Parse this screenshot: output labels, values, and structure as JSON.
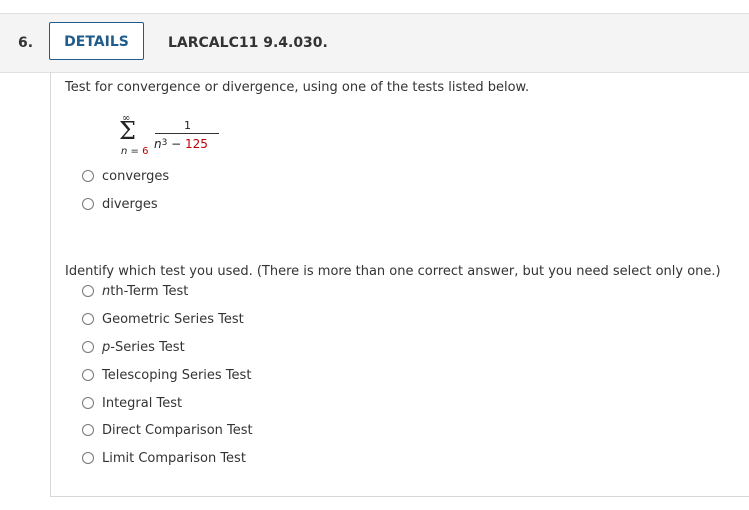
{
  "header": {
    "question_number": "6.",
    "details_label": "DETAILS",
    "problem_id": "LARCALC11 9.4.030."
  },
  "prompt": "Test for convergence or divergence, using one of the tests listed below.",
  "series": {
    "upper": "∞",
    "sigma": "Σ",
    "index_var": "n",
    "index_eq": " = ",
    "index_start": "6",
    "numerator": "1",
    "den_var": "n",
    "den_exp": "3",
    "den_op": " − ",
    "den_const": "125"
  },
  "answer_options": [
    {
      "label": "converges"
    },
    {
      "label": "diverges"
    }
  ],
  "test_prompt": "Identify which test you used. (There is more than one correct answer, but you need select only one.)",
  "test_options": [
    {
      "prefix": "n",
      "label": "th-Term Test"
    },
    {
      "prefix": "",
      "label": "Geometric Series Test"
    },
    {
      "prefix": "p",
      "label": "-Series Test"
    },
    {
      "prefix": "",
      "label": "Telescoping Series Test"
    },
    {
      "prefix": "",
      "label": "Integral Test"
    },
    {
      "prefix": "",
      "label": "Direct Comparison Test"
    },
    {
      "prefix": "",
      "label": "Limit Comparison Test"
    }
  ]
}
